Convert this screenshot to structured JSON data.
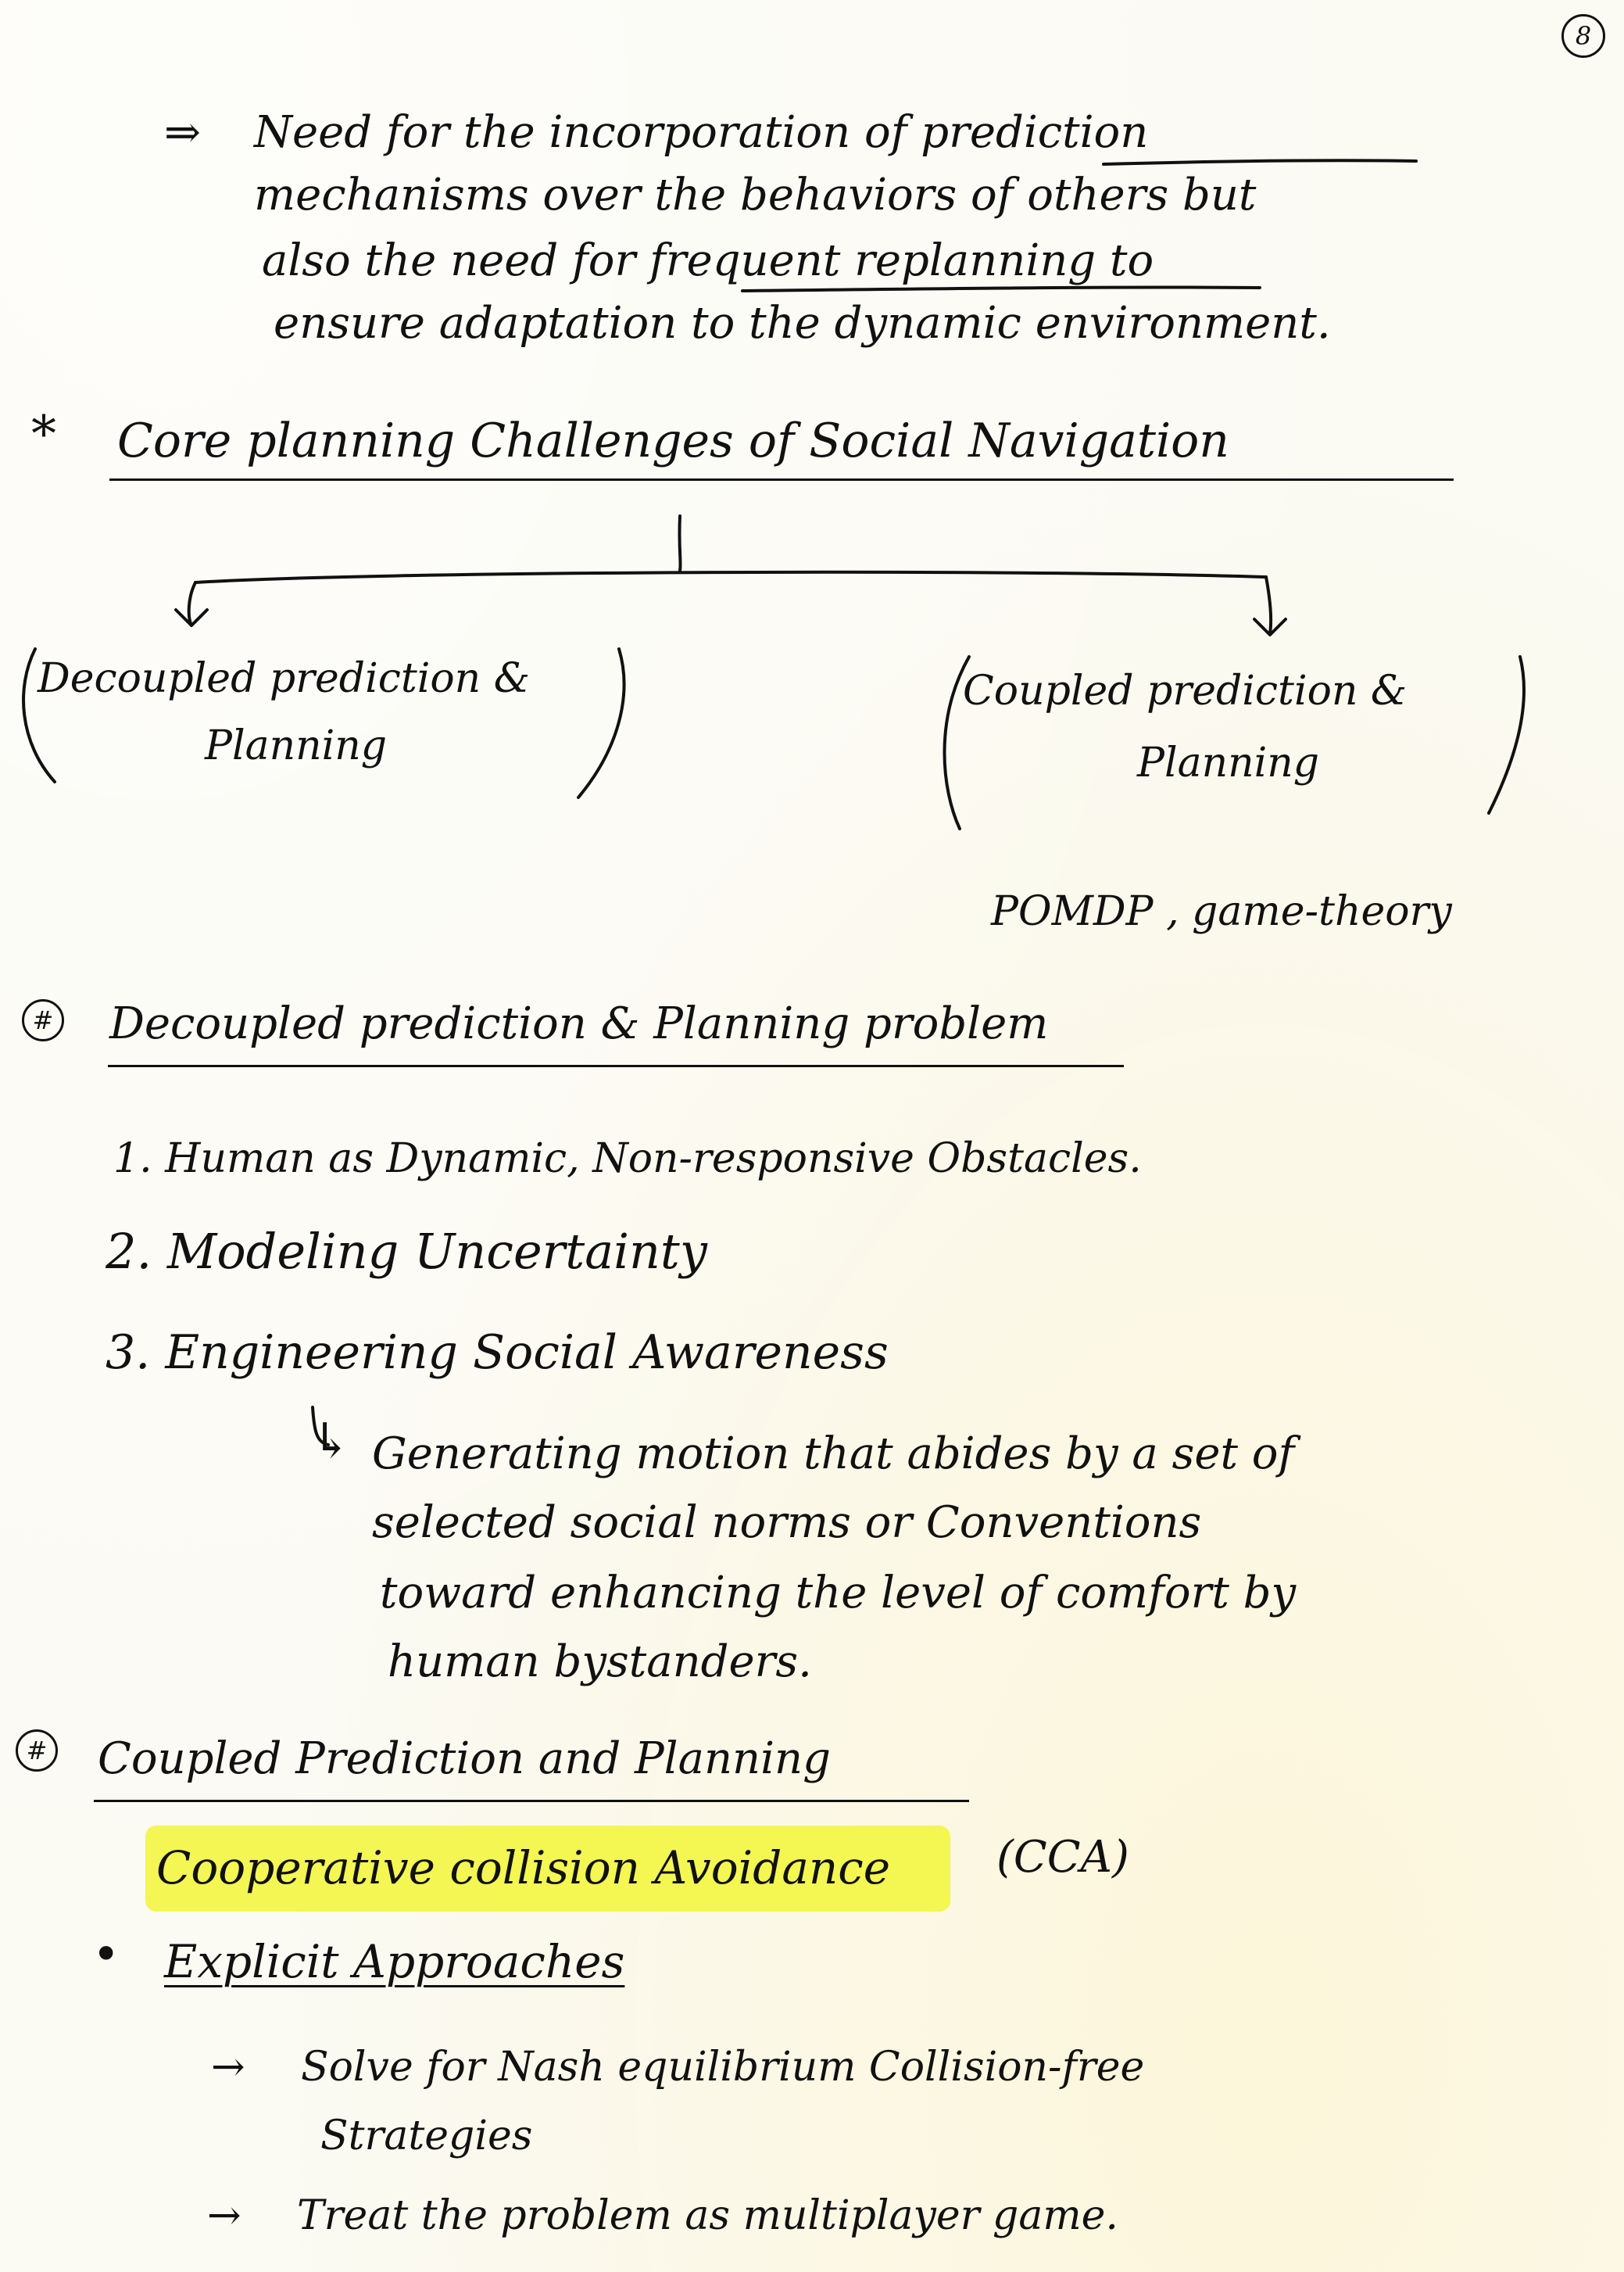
{
  "page_number": "8",
  "intro": {
    "arrow": "⇒",
    "lines": [
      "Need for the incorporation of prediction",
      "mechanisms over the behaviors of others but",
      "also the need for frequent replanning to",
      "ensure adaptation to the dynamic environment."
    ]
  },
  "core": {
    "bullet": "*",
    "heading": "Core planning Challenges of Social Navigation",
    "left_branch": {
      "line1": "Decoupled prediction &",
      "line2": "Planning"
    },
    "right_branch": {
      "line1": "Coupled prediction &",
      "line2": "Planning",
      "note": "POMDP , game-theory"
    }
  },
  "decoupled": {
    "marker": "#",
    "heading": "Decoupled prediction & Planning problem",
    "items": [
      "1. Human as Dynamic, Non-responsive Obstacles.",
      "2. Modeling Uncertainty",
      "3. Engineering Social Awareness"
    ],
    "sub_arrow": "↳",
    "sub_lines": [
      "Generating motion that abides by a set of",
      "selected social norms or Conventions",
      "toward enhancing the level of comfort by",
      "human bystanders."
    ]
  },
  "coupled": {
    "marker": "#",
    "heading": "Coupled Prediction and Planning",
    "highlight": "Cooperative collision Avoidance",
    "acronym": "(CCA)",
    "bullet": "•",
    "subheading": "Explicit Approaches",
    "points": [
      {
        "arrow": "→",
        "line1": "Solve for Nash equilibrium Collision-free",
        "line2": "Strategies"
      },
      {
        "arrow": "→",
        "line1": "Treat the problem as multiplayer game."
      }
    ]
  }
}
